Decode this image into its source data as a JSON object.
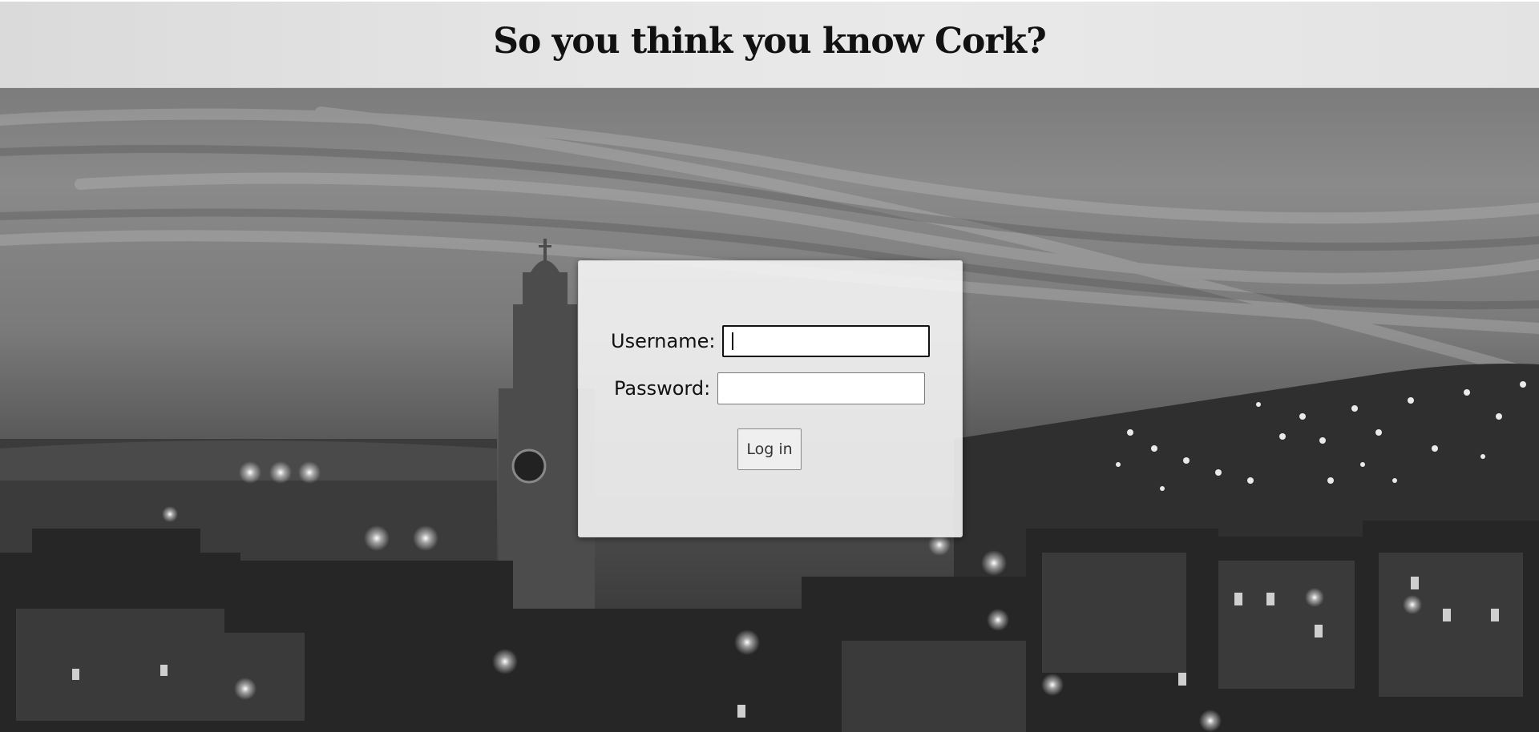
{
  "header": {
    "title": "So you think you know Cork?"
  },
  "login": {
    "username_label": "Username:",
    "username_value": "",
    "password_label": "Password:",
    "password_value": "",
    "submit_label": "Log in"
  },
  "colors": {
    "header_bg": "#e6e6e6",
    "title_text": "#111111",
    "panel_bg": "#f4f4f4"
  }
}
